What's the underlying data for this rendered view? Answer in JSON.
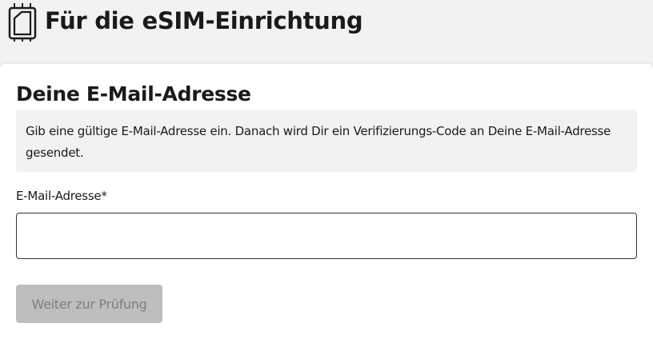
{
  "header": {
    "icon": "sim-card-icon",
    "title": "Für die eSIM-Einrichtung"
  },
  "form": {
    "title": "Deine E-Mail-Adresse",
    "info_text": "Gib eine gültige E-Mail-Adresse ein. Danach wird Dir ein Verifizierungs-Code an Deine E-Mail-Adresse gesendet.",
    "email_label": "E-Mail-Adresse*",
    "email_value": "",
    "submit_label": "Weiter zur Prüfung",
    "submit_enabled": false
  },
  "colors": {
    "page_background": "#f2f2f2",
    "card_background": "#ffffff",
    "text": "#1a1a1a",
    "input_border": "#333333",
    "button_disabled_background": "#bebebe",
    "button_disabled_text": "#7e7e7e"
  }
}
